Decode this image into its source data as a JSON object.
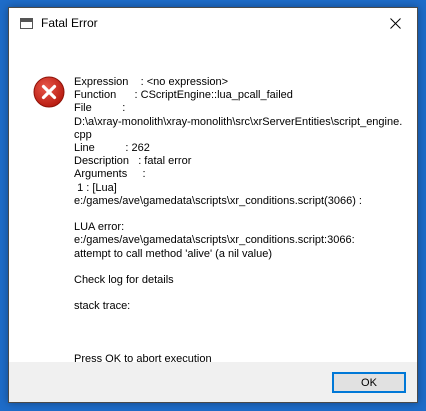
{
  "window": {
    "title": "Fatal Error",
    "close_icon": "close-icon",
    "app_icon": "window-icon"
  },
  "dialog": {
    "icon": "error-icon",
    "icon_color": "#c42b1c",
    "message_lines": [
      "Expression    : <no expression>",
      "Function      : CScriptEngine::lua_pcall_failed",
      "File          :",
      "D:\\a\\xray-monolith\\xray-monolith\\src\\xrServerEntities\\script_engine.cpp",
      "Line          : 262",
      "Description   : fatal error",
      "Arguments     :",
      " 1 : [Lua]",
      "e:/games/ave\\gamedata\\scripts\\xr_conditions.script(3066) :",
      "",
      "LUA error:",
      "e:/games/ave\\gamedata\\scripts\\xr_conditions.script:3066:",
      "attempt to call method 'alive' (a nil value)",
      "",
      "Check log for details",
      "",
      "stack trace:",
      "",
      "",
      "",
      "Press OK to abort execution"
    ]
  },
  "buttons": {
    "ok_label": "OK"
  }
}
